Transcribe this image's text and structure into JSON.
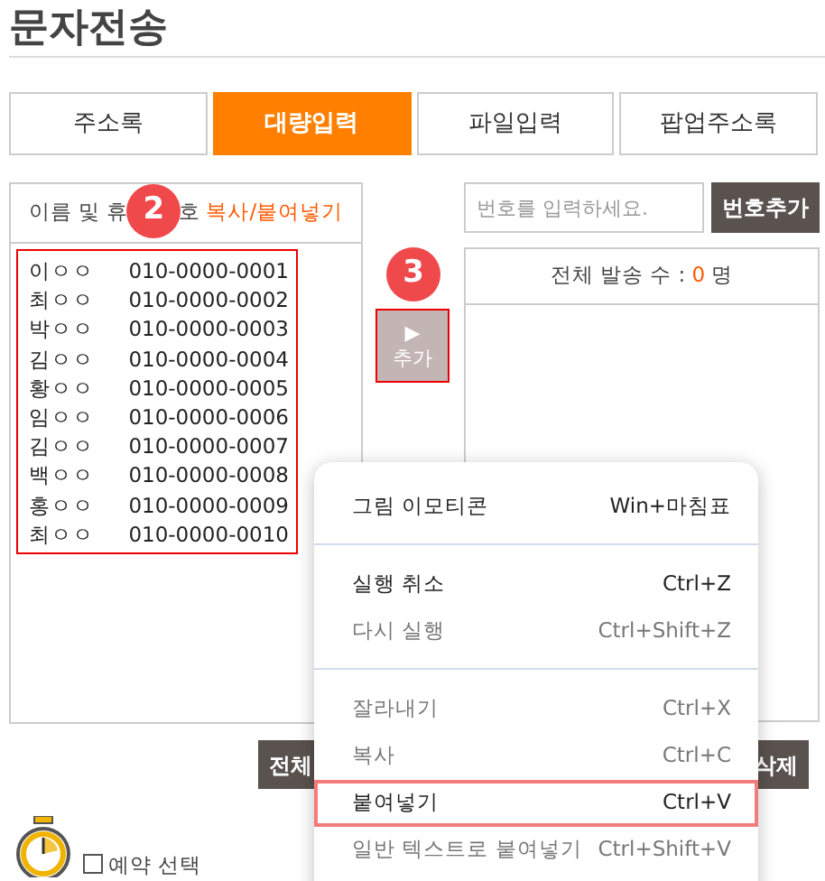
{
  "title": "문자전송",
  "tabs": [
    {
      "label": "주소록",
      "selected": false
    },
    {
      "label": "대량입력",
      "selected": true
    },
    {
      "label": "파일입력",
      "selected": false
    },
    {
      "label": "팝업주소록",
      "selected": false
    }
  ],
  "paste_panel": {
    "header_parts": [
      "이름 및 휴",
      "호"
    ],
    "header_link": "복사/붙여넣기",
    "step_badge": "2",
    "entries": [
      {
        "name": "이ㅇㅇ",
        "phone": "010-0000-0001"
      },
      {
        "name": "최ㅇㅇ",
        "phone": "010-0000-0002"
      },
      {
        "name": "박ㅇㅇ",
        "phone": "010-0000-0003"
      },
      {
        "name": "김ㅇㅇ",
        "phone": "010-0000-0004"
      },
      {
        "name": "황ㅇㅇ",
        "phone": "010-0000-0005"
      },
      {
        "name": "임ㅇㅇ",
        "phone": "010-0000-0006"
      },
      {
        "name": "김ㅇㅇ",
        "phone": "010-0000-0007"
      },
      {
        "name": "백ㅇㅇ",
        "phone": "010-0000-0008"
      },
      {
        "name": "홍ㅇㅇ",
        "phone": "010-0000-0009"
      },
      {
        "name": "최ㅇㅇ",
        "phone": "010-0000-0010"
      }
    ]
  },
  "add_step_badge": "3",
  "add_button": {
    "arrow": "▶",
    "label": "추가"
  },
  "number_input": {
    "placeholder": "번호를 입력하세요."
  },
  "number_add_button": "번호추가",
  "recipients": {
    "label": "전체 발송 수 : ",
    "count": "0",
    "unit": " 명"
  },
  "bottom_buttons": [
    "전체",
    "삭제"
  ],
  "reservation": {
    "label": "예약 선택",
    "checked": false
  },
  "context_menu": [
    {
      "kind": "item",
      "label": "그림 이모티콘",
      "shortcut": "Win+마침표",
      "disabled": false,
      "highlighted": false
    },
    {
      "kind": "divider"
    },
    {
      "kind": "item",
      "label": "실행 취소",
      "shortcut": "Ctrl+Z",
      "disabled": false,
      "highlighted": false
    },
    {
      "kind": "item",
      "label": "다시 실행",
      "shortcut": "Ctrl+Shift+Z",
      "disabled": true,
      "highlighted": false
    },
    {
      "kind": "divider"
    },
    {
      "kind": "item",
      "label": "잘라내기",
      "shortcut": "Ctrl+X",
      "disabled": true,
      "highlighted": false
    },
    {
      "kind": "item",
      "label": "복사",
      "shortcut": "Ctrl+C",
      "disabled": true,
      "highlighted": false
    },
    {
      "kind": "item",
      "label": "붙여넣기",
      "shortcut": "Ctrl+V",
      "disabled": false,
      "highlighted": true
    },
    {
      "kind": "item",
      "label": "일반 텍스트로 붙여넣기",
      "shortcut": "Ctrl+Shift+V",
      "disabled": true,
      "highlighted": false
    }
  ]
}
